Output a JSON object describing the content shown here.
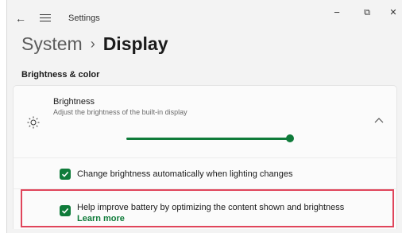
{
  "window": {
    "title": "Settings",
    "back_glyph": "←",
    "minimize_glyph": "−",
    "restore_glyph": "⧉",
    "close_glyph": "✕"
  },
  "breadcrumb": {
    "parent": "System",
    "separator": "›",
    "current": "Display"
  },
  "section": {
    "title": "Brightness & color"
  },
  "brightness": {
    "icon": "sun-icon",
    "label": "Brightness",
    "description": "Adjust the brightness of the built-in display",
    "level": 1.0,
    "expanded": true
  },
  "options": {
    "auto_brightness": {
      "label": "Change brightness automatically when lighting changes",
      "checked": true
    },
    "content_adaptive": {
      "label": "Help improve battery by optimizing the content shown and brightness",
      "link": "Learn more",
      "checked": true
    }
  },
  "colors": {
    "accent": "#0f7b3a",
    "highlight": "#e0455b"
  }
}
